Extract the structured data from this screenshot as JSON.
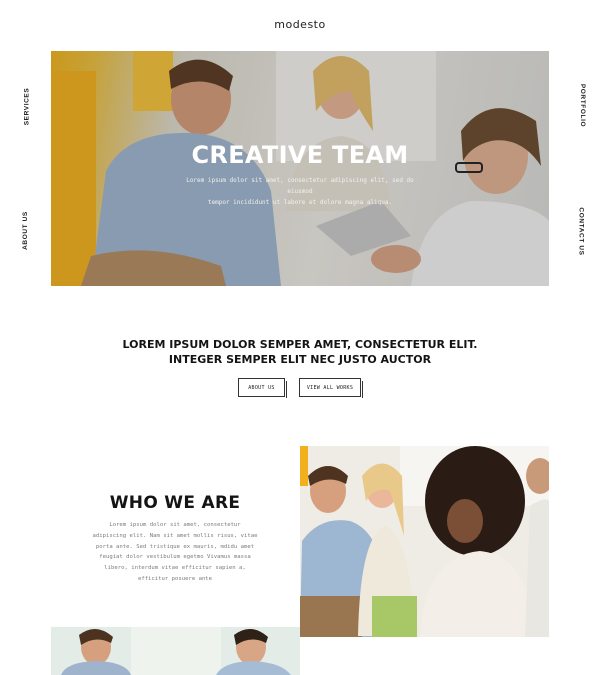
{
  "brand": {
    "logo": "modesto"
  },
  "side_nav": {
    "left": [
      "SERVICES",
      "ABOUT US"
    ],
    "right": [
      "PORTFOLIO",
      "CONTACT US"
    ]
  },
  "hero": {
    "title": "CREATIVE TEAM",
    "text_line1": "Lorem ipsum dolor sit amet, consectetur adipiscing elit, sed do eiusmod",
    "text_line2": "tempor incididunt ut labore et dolore magna aliqua."
  },
  "intro": {
    "headline_line1": "LOREM IPSUM DOLOR SEMPER AMET, CONSECTETUR ELIT.",
    "headline_line2": "INTEGER SEMPER ELIT NEC JUSTO AUCTOR",
    "about_button": "ABOUT US",
    "works_button": "VIEW ALL WORKS"
  },
  "who_we_are": {
    "title": "WHO WE ARE",
    "lines": [
      "Lorem ipsum dolor sit amet, consectetur",
      "adipiscing elit. Nam sit amet mollis risus, vitae",
      "porta ante. Sed tristique ex mauris, mdidu amet",
      "feugiat dolor vestibulum egetmo Vivamus massa",
      "libero, interdum vitae efficitur sapien a,",
      "efficitur posuere ante"
    ]
  },
  "colors": {
    "accent_yellow": "#f0b21a",
    "text_dark": "#141414",
    "text_muted": "#7b7b7b"
  }
}
